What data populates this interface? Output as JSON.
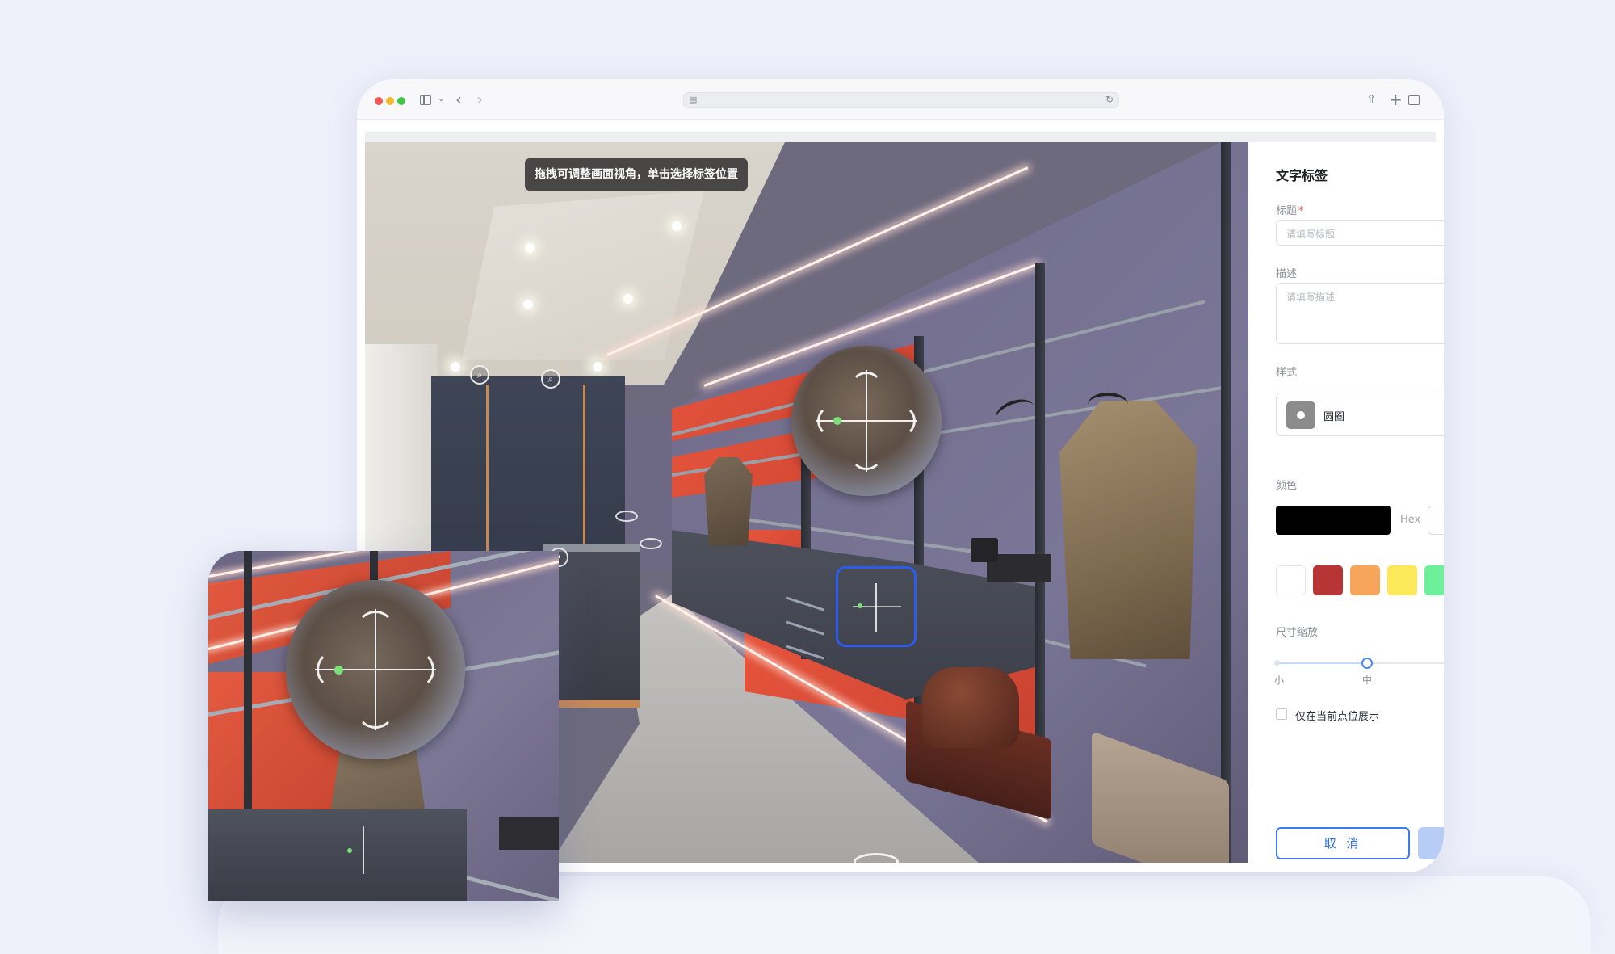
{
  "viewport": {
    "hint": "拖拽可调整画面视角，单击选择标签位置"
  },
  "panel": {
    "title": "文字标签",
    "title_field": {
      "label": "标题",
      "required_mark": "*",
      "placeholder": "请填写标题"
    },
    "description_field": {
      "label": "描述",
      "placeholder": "请填写描述"
    },
    "style": {
      "label": "样式",
      "selected": "圆圈"
    },
    "color": {
      "label": "颜色",
      "hex_label": "Hex",
      "selected": "#000000",
      "swatches": [
        "#ffffff",
        "#b83535",
        "#f7a55b",
        "#fbe95b",
        "#6ef09a"
      ]
    },
    "size": {
      "label": "尺寸缩放",
      "min_label": "小",
      "mid_label": "中",
      "value": "中"
    },
    "only_current_point": {
      "label": "仅在当前点位展示",
      "checked": false
    },
    "cancel_label": "取 消"
  },
  "colors": {
    "page_bg": "#eef1fa",
    "accent": "#2c5bf0"
  }
}
